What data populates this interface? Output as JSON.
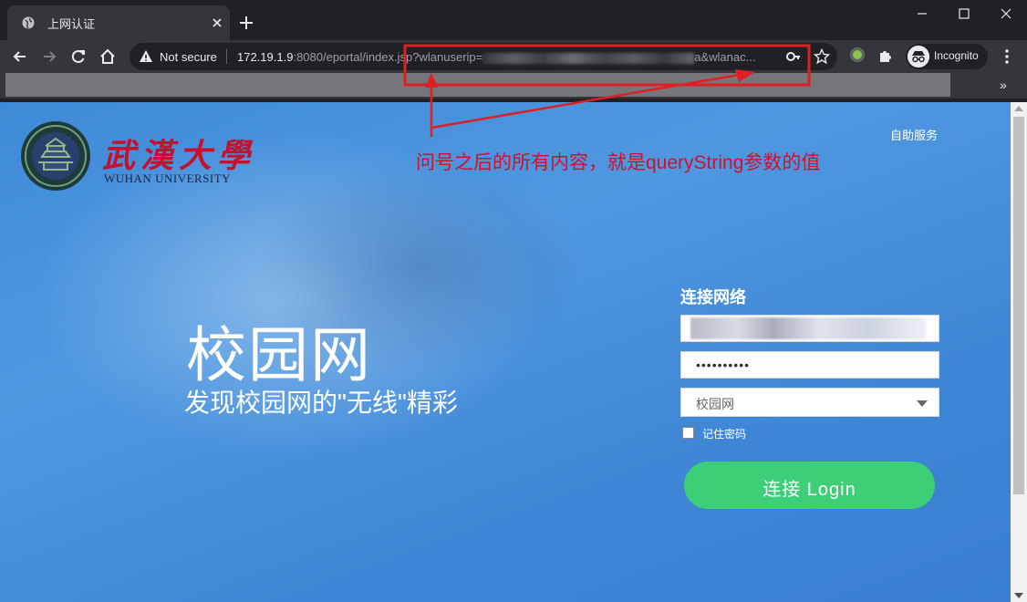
{
  "browser": {
    "tab_title": "上网认证",
    "new_tab": "+",
    "window_controls": {
      "minimize": "─",
      "maximize": "☐",
      "close": "✕"
    },
    "security_label": "Not secure",
    "url_host": "172.19.1.9",
    "url_rest": ":8080/eportal/index.jsp?wlanuserip=",
    "url_tail": "a&wlanac...",
    "incognito_label": "Incognito",
    "bookmarks_more": "»"
  },
  "page": {
    "university_name_cn": "武漢大學",
    "university_name_en": "WUHAN UNIVERSITY",
    "self_service_link": "自助服务",
    "annotation": "问号之后的所有内容，就是queryString参数的值",
    "hero_title": "校园网",
    "hero_subtitle": "发现校园网的\"无线\"精彩",
    "form": {
      "heading": "连接网络",
      "password_value": "••••••••••",
      "network_selected": "校园网",
      "remember_label": "记住密码",
      "login_button": "连接 Login"
    }
  },
  "colors": {
    "annotation_red": "#e02020",
    "login_green": "#3dcf78",
    "page_blue": "#4590dc"
  }
}
